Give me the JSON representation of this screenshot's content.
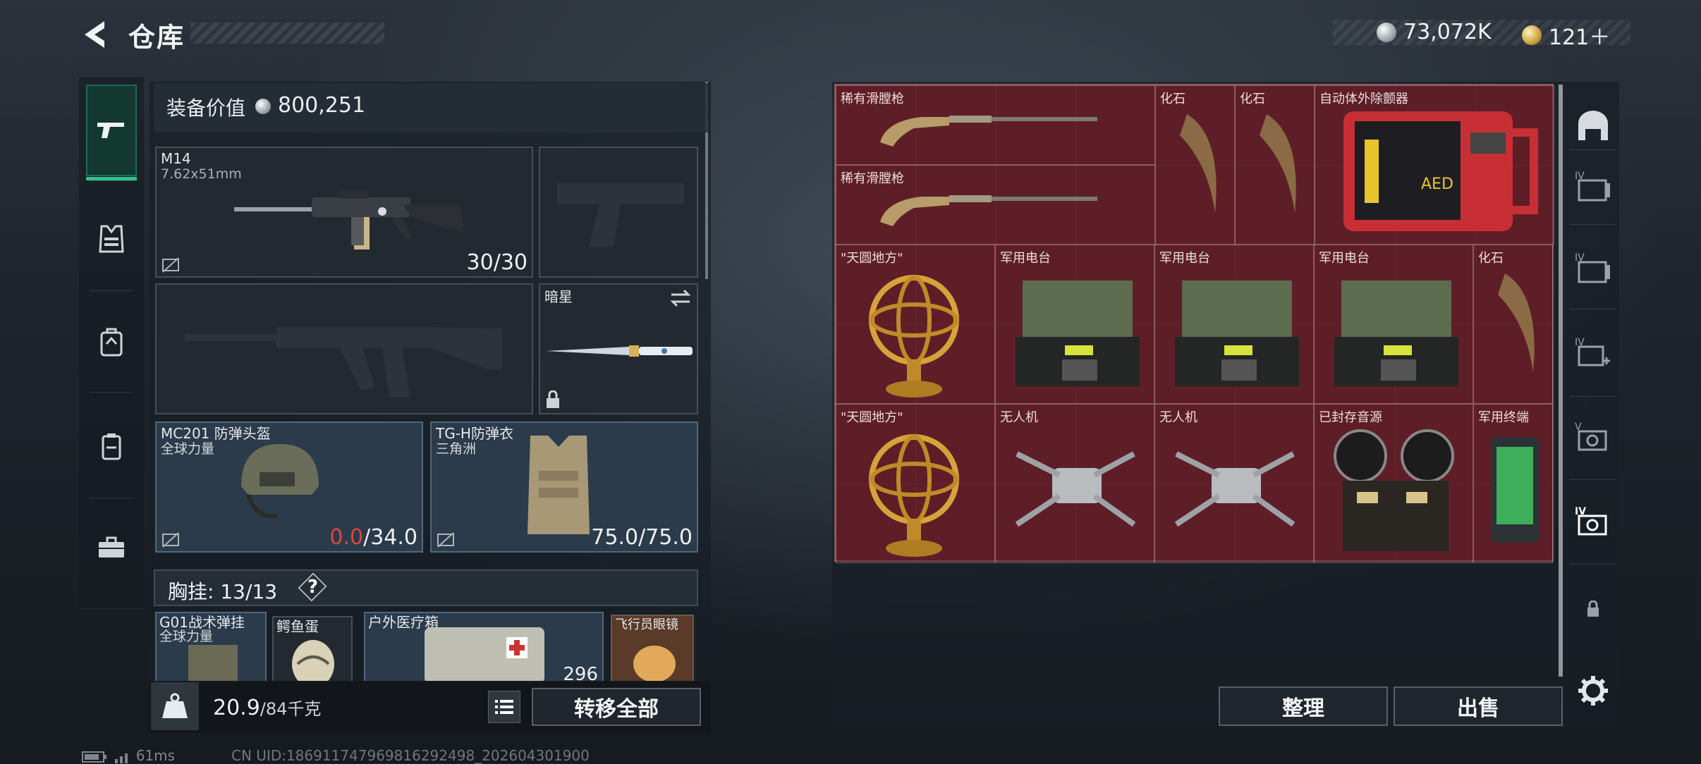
{
  "header": {
    "title": "仓库",
    "currency_silver": "73,072K",
    "currency_gold": "121＋"
  },
  "left_rail": [
    "weapon-tab",
    "vest-tab",
    "backpack-tab",
    "bag-tab",
    "case-tab"
  ],
  "loadout": {
    "value_label": "装备价值",
    "value": "800,251",
    "primary": {
      "name": "M14",
      "caliber": "7.62x51mm",
      "ammo": "30/30"
    },
    "melee": {
      "name": "暗星"
    },
    "helmet": {
      "name": "MC201 防弹头盔",
      "brand": "全球力量",
      "durability_current": "0.0",
      "durability_max": "/34.0"
    },
    "armor": {
      "name": "TG-H防弹衣",
      "brand": "三角洲",
      "durability": "75.0/75.0"
    },
    "chest_rig_label": "胸挂:",
    "chest_rig_count": "13/13",
    "help": "?",
    "rig_items": [
      {
        "name": "G01战术弹挂",
        "brand": "全球力量"
      },
      {
        "name": "鳄鱼蛋"
      },
      {
        "name": "户外医疗箱",
        "count": "296"
      },
      {
        "name": "飞行员眼镜"
      }
    ],
    "weight": "20.9",
    "weight_max": "/84千克",
    "weight_icon": "KG",
    "transfer_all": "转移全部"
  },
  "stash": {
    "items": [
      {
        "name": "稀有滑膛枪"
      },
      {
        "name": "稀有滑膛枪"
      },
      {
        "name": "化石"
      },
      {
        "name": "化石"
      },
      {
        "name": "自动体外除颤器"
      },
      {
        "name": "\"天圆地方\""
      },
      {
        "name": "军用电台"
      },
      {
        "name": "军用电台"
      },
      {
        "name": "军用电台"
      },
      {
        "name": "化石"
      },
      {
        "name": "\"天圆地方\""
      },
      {
        "name": "无人机"
      },
      {
        "name": "无人机"
      },
      {
        "name": "已封存音源"
      },
      {
        "name": "军用终端"
      }
    ],
    "aed_text": "AED",
    "sort_button": "整理",
    "sell_button": "出售"
  },
  "right_rail": [
    "home-tab",
    "IV",
    "IV",
    "IV",
    "V",
    "IV"
  ],
  "status": {
    "ping": "61ms",
    "uid": "CN UID:186911747969816292498_202604301900"
  },
  "colors": {
    "accent_green": "#2ec28f",
    "stash_red": "#5b1f27",
    "durability_red": "#e0453d"
  }
}
